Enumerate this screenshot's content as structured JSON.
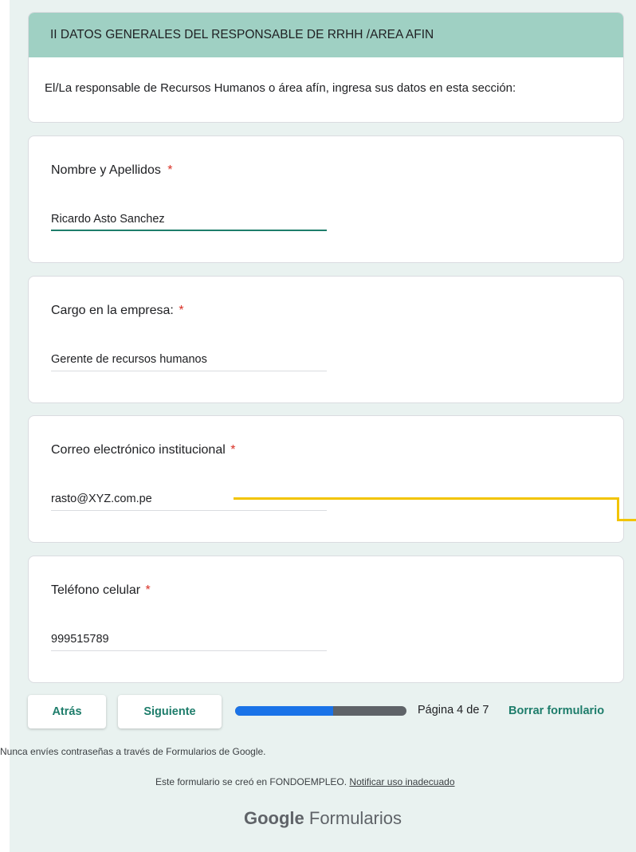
{
  "section": {
    "header": "II DATOS GENERALES DEL RESPONSABLE DE RRHH /AREA AFIN",
    "description": "El/La responsable de Recursos Humanos o área afín, ingresa sus datos en esta sección:"
  },
  "questions": [
    {
      "title": "Nombre y Apellidos",
      "required_mark": "*",
      "value": "Ricardo Asto Sanchez"
    },
    {
      "title": "Cargo en la empresa:",
      "required_mark": "*",
      "value": "Gerente de recursos humanos"
    },
    {
      "title": "Correo electrónico institucional",
      "required_mark": "*",
      "value": "rasto@XYZ.com.pe"
    },
    {
      "title": "Teléfono celular",
      "required_mark": "*",
      "value": "999515789"
    }
  ],
  "navigation": {
    "back_label": "Atrás",
    "next_label": "Siguiente",
    "progress_fraction": 0.57,
    "page_text": "Página 4 de 7",
    "clear_label": "Borrar formulario"
  },
  "footer": {
    "password_notice": "Nunca envíes contraseñas a través de Formularios de Google.",
    "created_text": "Este formulario se creó en FONDOEMPLEO.",
    "report_link": "Notificar uso inadecuado",
    "brand_google": "Google",
    "brand_product": "Formularios"
  },
  "colors": {
    "header_bg": "#9fd0c3",
    "accent": "#1e7d6b",
    "required": "#d93025",
    "progress_fill": "#1a73e8",
    "annotation": "#f2c400"
  }
}
